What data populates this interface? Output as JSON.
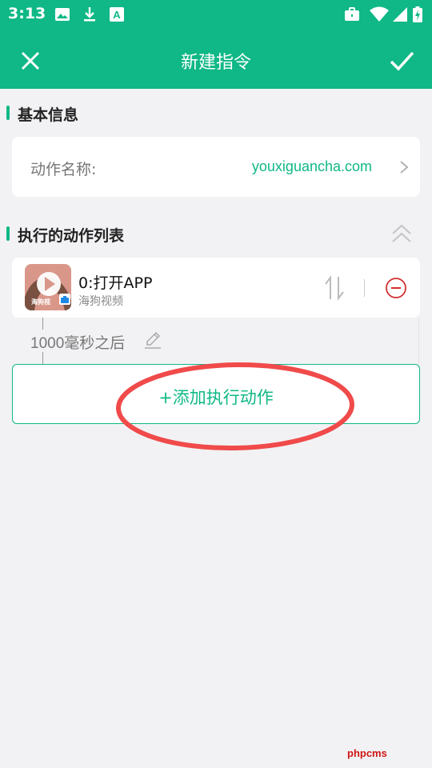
{
  "status_bar": {
    "time": "3:13",
    "icons": [
      "image-icon",
      "download-icon",
      "font-icon",
      "briefcase-icon",
      "wifi-icon",
      "signal-icon",
      "battery-charging-icon"
    ]
  },
  "app_bar": {
    "title": "新建指令",
    "close_icon": "close-icon",
    "confirm_icon": "check-icon"
  },
  "basic_info": {
    "section_title": "基本信息",
    "name_label": "动作名称:",
    "name_value": "youxiguancha.com"
  },
  "action_list": {
    "section_title": "执行的动作列表",
    "items": [
      {
        "title": "0:打开APP",
        "subtitle": "海狗视频",
        "icon_caption": "海狗视"
      }
    ],
    "delay_text": "1000毫秒之后",
    "add_button_label": "+添加执行动作"
  },
  "watermark": "phpcms",
  "colors": {
    "accent": "#0fb886",
    "danger": "#d32f2f",
    "annotation": "#f04a4a",
    "background": "#f2f2f4"
  }
}
